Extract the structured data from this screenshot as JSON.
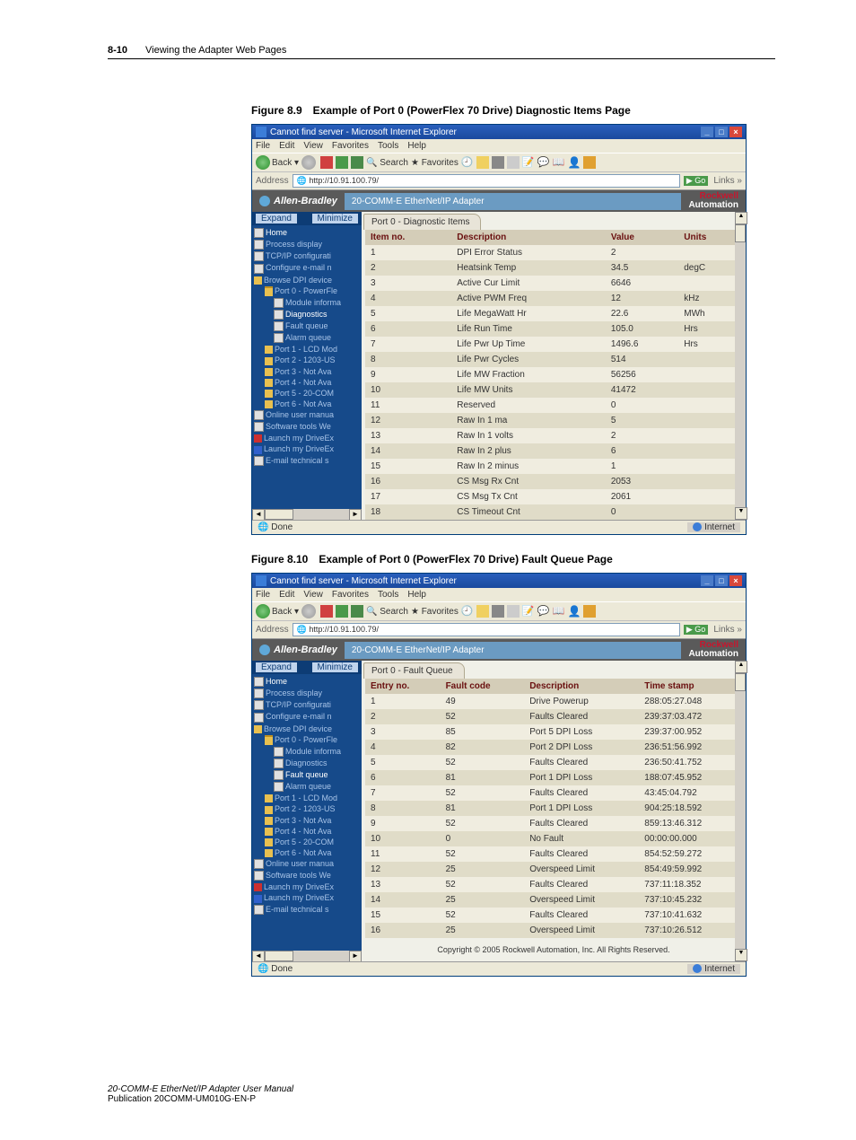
{
  "header": {
    "page_num": "8-10",
    "chapter": "Viewing the Adapter Web Pages"
  },
  "fig1": {
    "caption": "Figure 8.9 Example of Port 0 (PowerFlex 70 Drive) Diagnostic Items Page"
  },
  "fig2": {
    "caption": "Figure 8.10 Example of Port 0 (PowerFlex 70 Drive) Fault Queue Page"
  },
  "win": {
    "title": "Cannot find server - Microsoft Internet Explorer",
    "menus": [
      "File",
      "Edit",
      "View",
      "Favorites",
      "Tools",
      "Help"
    ],
    "back": "Back",
    "search": "Search",
    "favorites": "Favorites",
    "addr_label": "Address",
    "addr_value": "http://10.91.100.79/",
    "go": "Go",
    "links": "Links",
    "brand": "Allen-Bradley",
    "adapter": "20-COMM-E EtherNet/IP Adapter",
    "ra1": "Rockwell",
    "ra2": "Automation",
    "expand": "Expand",
    "minimize": "Minimize",
    "status_done": "Done",
    "status_net": "Internet"
  },
  "nav": [
    {
      "t": "Home",
      "c": "white",
      "i": "ic-doc"
    },
    {
      "t": "Process display",
      "c": "",
      "i": "ic-doc"
    },
    {
      "t": "TCP/IP configurati",
      "c": "",
      "i": "ic-doc"
    },
    {
      "t": "Configure e-mail n",
      "c": "",
      "i": "ic-doc"
    },
    {
      "t": "Browse DPI device",
      "c": "",
      "i": "ic-fold"
    },
    {
      "t": "Port 0 - PowerFle",
      "c": "",
      "i": "ic-foldo",
      "indent": 1
    },
    {
      "t": "Module informa",
      "c": "",
      "i": "ic-doc",
      "indent": 2
    },
    {
      "t": "Diagnostics",
      "c": "white",
      "i": "ic-doc",
      "indent": 2
    },
    {
      "t": "Fault queue",
      "c": "",
      "i": "ic-doc",
      "indent": 2
    },
    {
      "t": "Alarm queue",
      "c": "",
      "i": "ic-doc",
      "indent": 2
    },
    {
      "t": "Port 1 - LCD Mod",
      "c": "",
      "i": "ic-fold",
      "indent": 1
    },
    {
      "t": "Port 2 - 1203-US",
      "c": "",
      "i": "ic-fold",
      "indent": 1
    },
    {
      "t": "Port 3 - Not Ava",
      "c": "",
      "i": "ic-fold",
      "indent": 1
    },
    {
      "t": "Port 4 - Not Ava",
      "c": "",
      "i": "ic-fold",
      "indent": 1
    },
    {
      "t": "Port 5 - 20-COM",
      "c": "",
      "i": "ic-fold",
      "indent": 1
    },
    {
      "t": "Port 6 - Not Ava",
      "c": "",
      "i": "ic-fold",
      "indent": 1
    },
    {
      "t": "Online user manua",
      "c": "",
      "i": "ic-doc"
    },
    {
      "t": "Software tools We",
      "c": "",
      "i": "ic-doc"
    },
    {
      "t": "Launch my DriveEx",
      "c": "",
      "i": "ic-red"
    },
    {
      "t": "Launch my DriveEx",
      "c": "",
      "i": "ic-blue"
    },
    {
      "t": "E-mail technical s",
      "c": "",
      "i": "ic-doc"
    }
  ],
  "nav2": [
    {
      "t": "Home",
      "c": "white",
      "i": "ic-doc"
    },
    {
      "t": "Process display",
      "c": "",
      "i": "ic-doc"
    },
    {
      "t": "TCP/IP configurati",
      "c": "",
      "i": "ic-doc"
    },
    {
      "t": "Configure e-mail n",
      "c": "",
      "i": "ic-doc"
    },
    {
      "t": "Browse DPI device",
      "c": "",
      "i": "ic-fold"
    },
    {
      "t": "Port 0 - PowerFle",
      "c": "",
      "i": "ic-foldo",
      "indent": 1
    },
    {
      "t": "Module informa",
      "c": "",
      "i": "ic-doc",
      "indent": 2
    },
    {
      "t": "Diagnostics",
      "c": "",
      "i": "ic-doc",
      "indent": 2
    },
    {
      "t": "Fault queue",
      "c": "white",
      "i": "ic-doc",
      "indent": 2
    },
    {
      "t": "Alarm queue",
      "c": "",
      "i": "ic-doc",
      "indent": 2
    },
    {
      "t": "Port 1 - LCD Mod",
      "c": "",
      "i": "ic-fold",
      "indent": 1
    },
    {
      "t": "Port 2 - 1203-US",
      "c": "",
      "i": "ic-fold",
      "indent": 1
    },
    {
      "t": "Port 3 - Not Ava",
      "c": "",
      "i": "ic-fold",
      "indent": 1
    },
    {
      "t": "Port 4 - Not Ava",
      "c": "",
      "i": "ic-fold",
      "indent": 1
    },
    {
      "t": "Port 5 - 20-COM",
      "c": "",
      "i": "ic-fold",
      "indent": 1
    },
    {
      "t": "Port 6 - Not Ava",
      "c": "",
      "i": "ic-fold",
      "indent": 1
    },
    {
      "t": "Online user manua",
      "c": "",
      "i": "ic-doc"
    },
    {
      "t": "Software tools We",
      "c": "",
      "i": "ic-doc"
    },
    {
      "t": "Launch my DriveEx",
      "c": "",
      "i": "ic-red"
    },
    {
      "t": "Launch my DriveEx",
      "c": "",
      "i": "ic-blue"
    },
    {
      "t": "E-mail technical s",
      "c": "",
      "i": "ic-doc"
    }
  ],
  "diag": {
    "tab": "Port 0 - Diagnostic Items",
    "headers": [
      "Item no.",
      "Description",
      "Value",
      "Units"
    ],
    "rows": [
      [
        "1",
        "DPI Error Status",
        "2",
        ""
      ],
      [
        "2",
        "Heatsink Temp",
        "34.5",
        "degC"
      ],
      [
        "3",
        "Active Cur Limit",
        "6646",
        ""
      ],
      [
        "4",
        "Active PWM Freq",
        "12",
        "kHz"
      ],
      [
        "5",
        "Life MegaWatt Hr",
        "22.6",
        "MWh"
      ],
      [
        "6",
        "Life Run Time",
        "105.0",
        "Hrs"
      ],
      [
        "7",
        "Life Pwr Up Time",
        "1496.6",
        "Hrs"
      ],
      [
        "8",
        "Life Pwr Cycles",
        "514",
        ""
      ],
      [
        "9",
        "Life MW Fraction",
        "56256",
        ""
      ],
      [
        "10",
        "Life MW Units",
        "41472",
        ""
      ],
      [
        "11",
        "Reserved",
        "0",
        ""
      ],
      [
        "12",
        "Raw In 1 ma",
        "5",
        ""
      ],
      [
        "13",
        "Raw In 1 volts",
        "2",
        ""
      ],
      [
        "14",
        "Raw In 2 plus",
        "6",
        ""
      ],
      [
        "15",
        "Raw In 2 minus",
        "1",
        ""
      ],
      [
        "16",
        "CS Msg Rx Cnt",
        "2053",
        ""
      ],
      [
        "17",
        "CS Msg Tx Cnt",
        "2061",
        ""
      ],
      [
        "18",
        "CS Timeout Cnt",
        "0",
        ""
      ]
    ]
  },
  "fault": {
    "tab": "Port 0 - Fault Queue",
    "headers": [
      "Entry no.",
      "Fault code",
      "Description",
      "Time stamp"
    ],
    "rows": [
      [
        "1",
        "49",
        "Drive Powerup",
        "288:05:27.048"
      ],
      [
        "2",
        "52",
        "Faults Cleared",
        "239:37:03.472"
      ],
      [
        "3",
        "85",
        "Port 5 DPI Loss",
        "239:37:00.952"
      ],
      [
        "4",
        "82",
        "Port 2 DPI Loss",
        "236:51:56.992"
      ],
      [
        "5",
        "52",
        "Faults Cleared",
        "236:50:41.752"
      ],
      [
        "6",
        "81",
        "Port 1 DPI Loss",
        "188:07:45.952"
      ],
      [
        "7",
        "52",
        "Faults Cleared",
        "43:45:04.792"
      ],
      [
        "8",
        "81",
        "Port 1 DPI Loss",
        "904:25:18.592"
      ],
      [
        "9",
        "52",
        "Faults Cleared",
        "859:13:46.312"
      ],
      [
        "10",
        "0",
        "No Fault",
        "00:00:00.000"
      ],
      [
        "11",
        "52",
        "Faults Cleared",
        "854:52:59.272"
      ],
      [
        "12",
        "25",
        "Overspeed Limit",
        "854:49:59.992"
      ],
      [
        "13",
        "52",
        "Faults Cleared",
        "737:11:18.352"
      ],
      [
        "14",
        "25",
        "Overspeed Limit",
        "737:10:45.232"
      ],
      [
        "15",
        "52",
        "Faults Cleared",
        "737:10:41.632"
      ],
      [
        "16",
        "25",
        "Overspeed Limit",
        "737:10:26.512"
      ]
    ],
    "copyright": "Copyright © 2005 Rockwell Automation, Inc. All Rights Reserved."
  },
  "footer": {
    "l1": "20-COMM-E EtherNet/IP Adapter User Manual",
    "l2": "Publication 20COMM-UM010G-EN-P"
  }
}
